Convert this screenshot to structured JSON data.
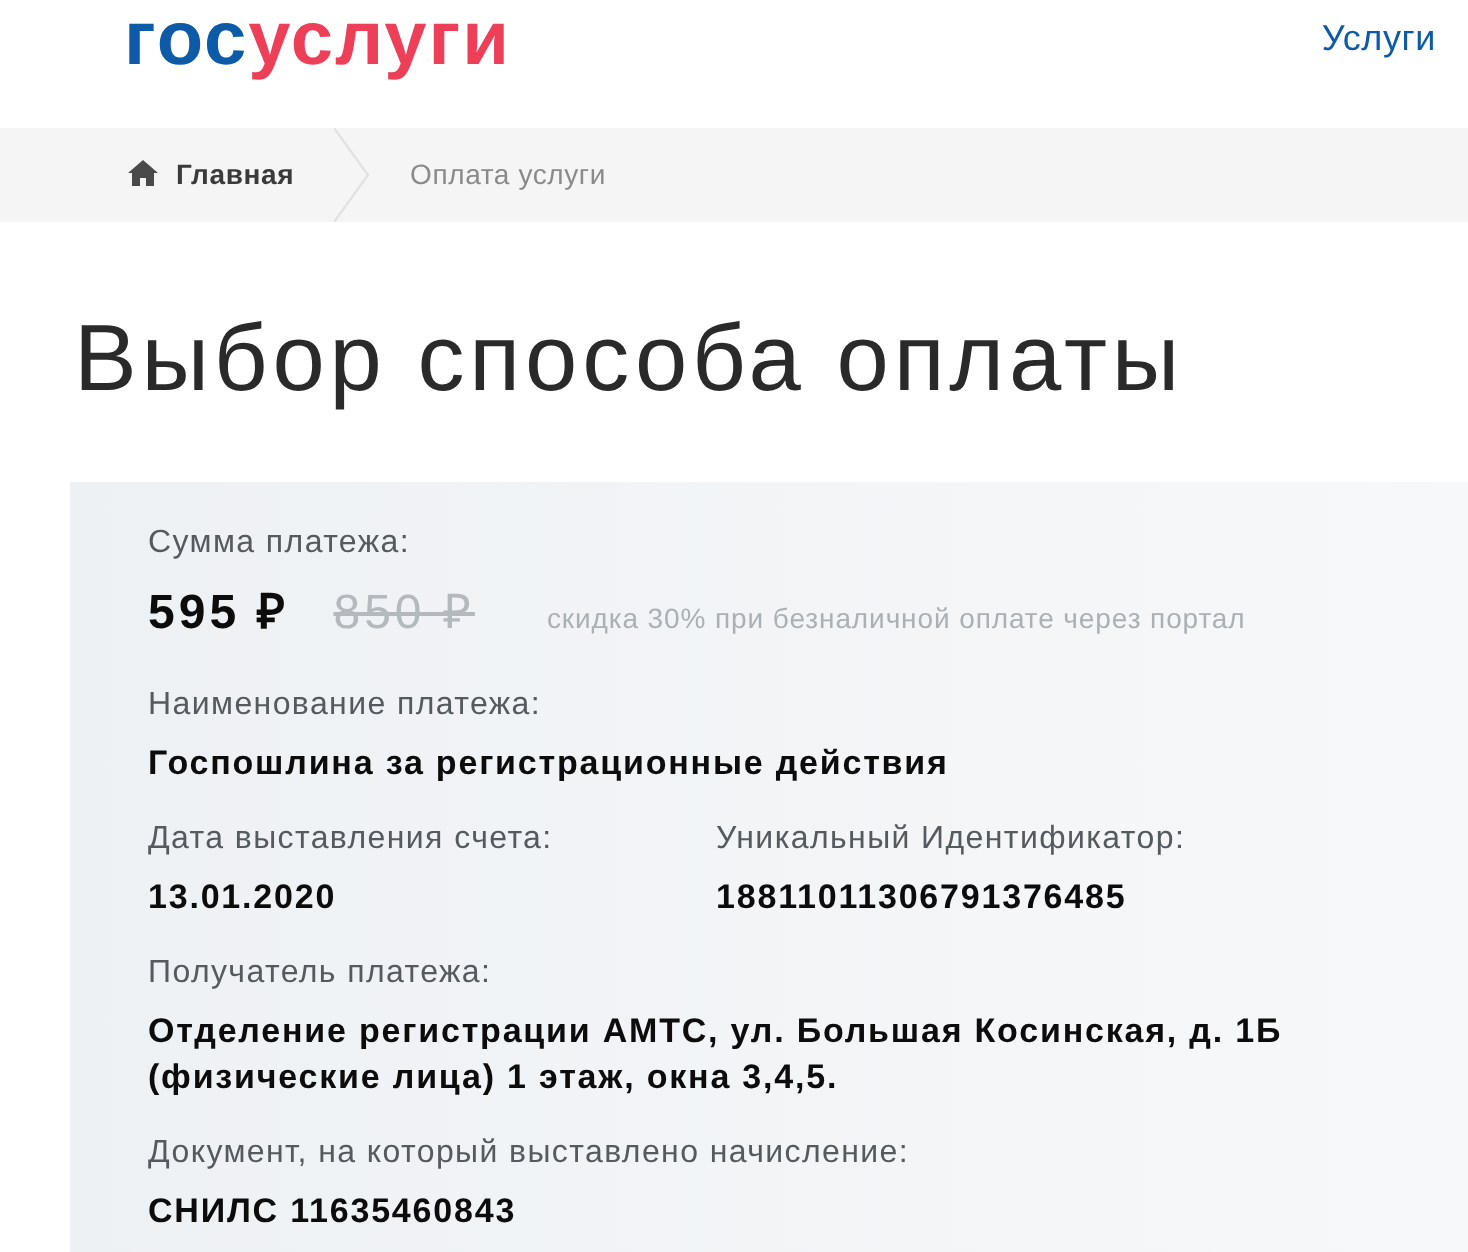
{
  "header": {
    "logo": [
      {
        "text": "гос",
        "color": "#0d5aa7"
      },
      {
        "text": "услуги",
        "color": "#ee3f58"
      }
    ],
    "nav_link": "Услуги"
  },
  "breadcrumbs": [
    {
      "label": "Главная",
      "kind": "home"
    },
    {
      "label": "Оплата услуги",
      "kind": "current"
    }
  ],
  "page_title": "Выбор способа оплаты",
  "payment": {
    "amount_label": "Сумма платежа:",
    "amount": "595 ₽",
    "old_amount": "850 ₽",
    "discount_note": "скидка 30% при безналичной оплате через портал",
    "rows": [
      {
        "fields": [
          {
            "label": "Наименование платежа:",
            "value": "Госпошлина за регистрационные действия"
          }
        ]
      },
      {
        "fields": [
          {
            "label": "Дата выставления счета:",
            "value": "13.01.2020"
          },
          {
            "label": "Уникальный Идентификатор:",
            "value": "18811011306791376485"
          }
        ]
      },
      {
        "fields": [
          {
            "label": "Получатель платежа:",
            "value": "Отделение регистрации АМТС, ул. Большая Косинская, д. 1Б (физические лица) 1 этаж, окна 3,4,5."
          }
        ]
      },
      {
        "fields": [
          {
            "label": "Документ, на который выставлено начисление:",
            "value": "СНИЛС 11635460843"
          }
        ]
      }
    ]
  }
}
